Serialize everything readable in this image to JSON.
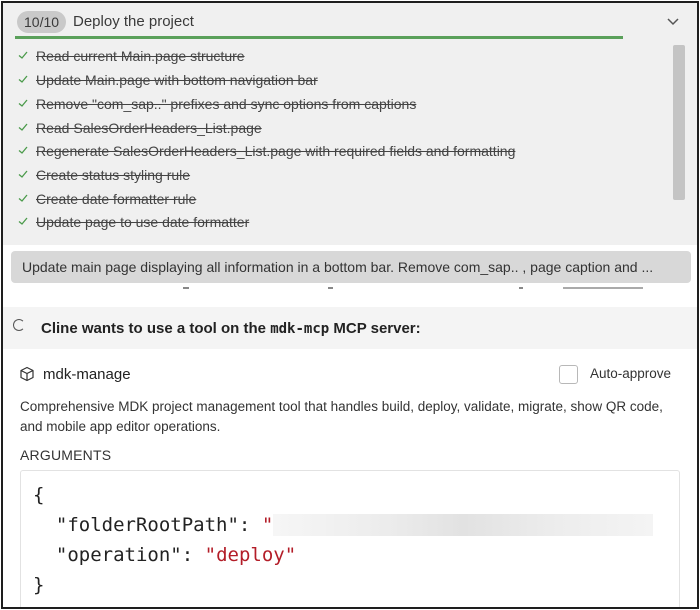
{
  "task": {
    "badge": "10/10",
    "title": "Deploy the project",
    "progress": 1.0,
    "items": [
      "Read current Main.page structure",
      "Update Main.page with bottom navigation bar",
      "Remove \"com_sap..\" prefixes and sync options from captions",
      "Read SalesOrderHeaders_List.page",
      "Regenerate SalesOrderHeaders_List.page with required fields and formatting",
      "Create status styling rule",
      "Create date formatter rule",
      "Update page to use date formatter"
    ]
  },
  "summary": {
    "text": "Update main page displaying all information in a bottom bar. Remove com_sap.. , page caption and ..."
  },
  "cline": {
    "title_prefix": "Cline wants to use a tool on the ",
    "server": "mdk-mcp",
    "title_suffix": " MCP server:"
  },
  "tool": {
    "name": "mdk-manage",
    "auto_approve_label": "Auto-approve",
    "auto_approve_checked": false,
    "description": "Comprehensive MDK project management tool that handles build, deploy, validate, migrate, show QR code, and mobile app editor operations.",
    "arguments_label": "ARGUMENTS",
    "code": {
      "open": "{",
      "key1": "\"folderRootPath\"",
      "sep1": ": ",
      "val1_start": "\"",
      "key2": "\"operation\"",
      "sep2": ": ",
      "val2": "\"deploy\"",
      "close": "}"
    }
  },
  "colors": {
    "progress": "#5aa05a",
    "check": "#4a9a4a",
    "string": "#b31d28"
  },
  "icons": {
    "chevron": "chevron-down-icon",
    "check": "check-icon",
    "spinner": "spinner-icon",
    "tool": "cube-icon"
  }
}
